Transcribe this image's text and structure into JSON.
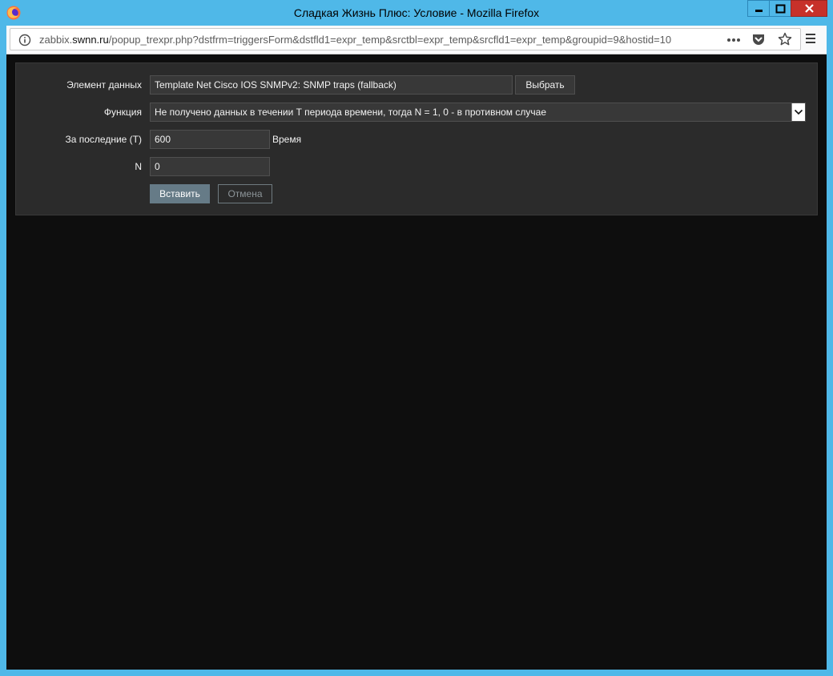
{
  "window": {
    "title": "Сладкая Жизнь Плюс: Условие - Mozilla Firefox"
  },
  "browser": {
    "url_prefix": "zabbix.",
    "url_host": "swnn.ru",
    "url_rest": "/popup_trexpr.php?dstfrm=triggersForm&dstfld1=expr_temp&srctbl=expr_temp&srcfld1=expr_temp&groupid=9&hostid=10"
  },
  "form": {
    "item": {
      "label": "Элемент данных",
      "value": "Template Net Cisco IOS SNMPv2: SNMP traps (fallback)",
      "select_button": "Выбрать"
    },
    "function": {
      "label": "Функция",
      "value": "Не получено данных в течении T периода времени, тогда N = 1, 0 - в противном случае"
    },
    "last": {
      "label": "За последние (T)",
      "value": "600",
      "unit": "Время"
    },
    "n": {
      "label": "N",
      "value": "0"
    },
    "buttons": {
      "insert": "Вставить",
      "cancel": "Отмена"
    }
  },
  "colors": {
    "titlebar": "#4fb8e8",
    "content_background": "#0e0e0e",
    "panel_background": "#2b2b2b",
    "primary_button": "#667b87"
  }
}
